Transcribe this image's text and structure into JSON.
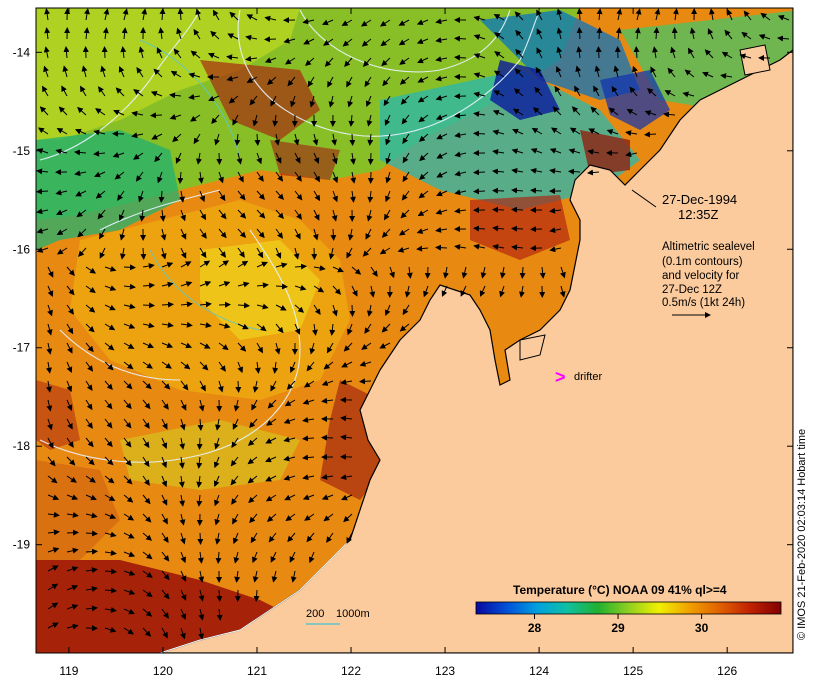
{
  "map": {
    "lon_ticks": [
      "119",
      "120",
      "121",
      "122",
      "123",
      "124",
      "125",
      "126"
    ],
    "lat_ticks": [
      "-14",
      "-15",
      "-16",
      "-17",
      "-18",
      "-19"
    ],
    "lon_range": [
      118.65,
      126.7
    ],
    "lat_range": [
      -20.1,
      -13.55
    ],
    "colors": {
      "land": "#fbcb9e",
      "arrow": "#000000",
      "contour": "#e8f4ff",
      "drifter": "#ff00ff",
      "bathy": "#5ec6c8"
    }
  },
  "labels": {
    "date": "27-Dec-1994",
    "time": "12:35Z",
    "alti_lines": [
      "Altimetric sealevel",
      "(0.1m contours)",
      "and velocity for",
      "27-Dec 12Z",
      "0.5m/s (1kt 24h)"
    ],
    "drifter": "drifter",
    "bathy_200": "200",
    "bathy_1000": "1000m",
    "credit": "© IMOS 21-Feb-2020 02:03:14 Hobart time"
  },
  "colorbar": {
    "title": "Temperature (°C) NOAA 09 41% ql>=4",
    "ticks": [
      "28",
      "29",
      "30"
    ],
    "tick_values": [
      28,
      29,
      30
    ],
    "range": [
      27.3,
      30.95
    ],
    "stops": [
      "#08089e",
      "#0050d8",
      "#00a0e0",
      "#10c0a0",
      "#20b030",
      "#90d020",
      "#f0f000",
      "#f0a000",
      "#e06000",
      "#c02000",
      "#800000"
    ]
  }
}
